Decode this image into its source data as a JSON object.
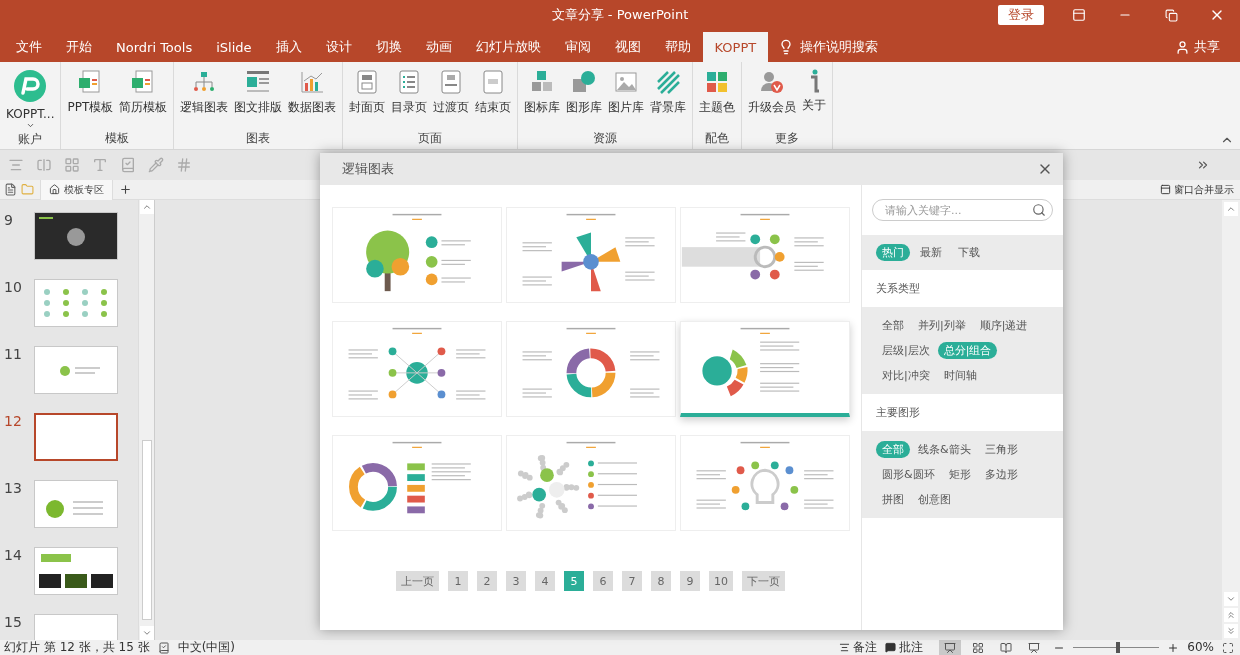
{
  "window": {
    "title": "文章分享 - PowerPoint",
    "login": "登录"
  },
  "menu_tabs": [
    {
      "label": "文件",
      "selected": false
    },
    {
      "label": "开始",
      "selected": false
    },
    {
      "label": "Nordri Tools",
      "selected": false
    },
    {
      "label": "iSlide",
      "selected": false
    },
    {
      "label": "插入",
      "selected": false
    },
    {
      "label": "设计",
      "selected": false
    },
    {
      "label": "切换",
      "selected": false
    },
    {
      "label": "动画",
      "selected": false
    },
    {
      "label": "幻灯片放映",
      "selected": false
    },
    {
      "label": "审阅",
      "selected": false
    },
    {
      "label": "视图",
      "selected": false
    },
    {
      "label": "帮助",
      "selected": false
    },
    {
      "label": "KOPPT",
      "selected": true
    }
  ],
  "tell_me": "操作说明搜索",
  "share": "共享",
  "ribbon_groups": [
    {
      "label": "账户",
      "buttons": [
        {
          "label": "KOPPT...",
          "kind": "logo"
        }
      ]
    },
    {
      "label": "模板",
      "buttons": [
        {
          "label": "PPT模板",
          "kind": "ppt"
        },
        {
          "label": "简历模板",
          "kind": "cv"
        }
      ]
    },
    {
      "label": "图表",
      "buttons": [
        {
          "label": "逻辑图表",
          "kind": "org"
        },
        {
          "label": "图文排版",
          "kind": "layout"
        },
        {
          "label": "数据图表",
          "kind": "chart"
        }
      ]
    },
    {
      "label": "页面",
      "buttons": [
        {
          "label": "封面页",
          "kind": "cover"
        },
        {
          "label": "目录页",
          "kind": "list"
        },
        {
          "label": "过渡页",
          "kind": "transition"
        },
        {
          "label": "结束页",
          "kind": "end"
        }
      ]
    },
    {
      "label": "资源",
      "buttons": [
        {
          "label": "图标库",
          "kind": "cubes"
        },
        {
          "label": "图形库",
          "kind": "shapes"
        },
        {
          "label": "图片库",
          "kind": "image"
        },
        {
          "label": "背景库",
          "kind": "stripes"
        }
      ]
    },
    {
      "label": "配色",
      "buttons": [
        {
          "label": "主题色",
          "kind": "palette"
        }
      ]
    },
    {
      "label": "更多",
      "buttons": [
        {
          "label": "升级会员",
          "kind": "vip"
        },
        {
          "label": "关于",
          "kind": "info"
        }
      ]
    }
  ],
  "doc_tab": "模板专区",
  "merge_window": "窗口合并显示",
  "slides": [
    {
      "number": "9",
      "selected": false,
      "kind": "dark"
    },
    {
      "number": "10",
      "selected": false,
      "kind": "grid"
    },
    {
      "number": "11",
      "selected": false,
      "kind": "light"
    },
    {
      "number": "12",
      "selected": true,
      "kind": "blank"
    },
    {
      "number": "13",
      "selected": false,
      "kind": "green"
    },
    {
      "number": "14",
      "selected": false,
      "kind": "photos"
    },
    {
      "number": "15",
      "selected": false,
      "kind": "blank"
    }
  ],
  "dialog": {
    "title": "逻辑图表",
    "templates": [
      {
        "kind": "tree",
        "selected": false
      },
      {
        "kind": "pinwheel",
        "selected": false
      },
      {
        "kind": "flow",
        "selected": false
      },
      {
        "kind": "radial",
        "selected": false
      },
      {
        "kind": "circle",
        "selected": false
      },
      {
        "kind": "fan",
        "selected": true
      },
      {
        "kind": "ring",
        "selected": false
      },
      {
        "kind": "bubbles",
        "selected": false
      },
      {
        "kind": "bulb",
        "selected": false
      }
    ],
    "pagination": {
      "prev": "上一页",
      "next": "下一页",
      "pages": [
        {
          "label": "1",
          "selected": false
        },
        {
          "label": "2",
          "selected": false
        },
        {
          "label": "3",
          "selected": false
        },
        {
          "label": "4",
          "selected": false
        },
        {
          "label": "5",
          "selected": true
        },
        {
          "label": "6",
          "selected": false
        },
        {
          "label": "7",
          "selected": false
        },
        {
          "label": "8",
          "selected": false
        },
        {
          "label": "9",
          "selected": false
        },
        {
          "label": "10",
          "selected": false
        }
      ]
    },
    "search": {
      "placeholder": "请输入关键字..."
    },
    "sort_tabs": [
      {
        "label": "热门",
        "selected": true
      },
      {
        "label": "最新",
        "selected": false
      },
      {
        "label": "下载",
        "selected": false
      }
    ],
    "sections": [
      {
        "title": "关系类型",
        "options": [
          {
            "label": "全部",
            "selected": false
          },
          {
            "label": "并列|列举",
            "selected": false
          },
          {
            "label": "顺序|递进",
            "selected": false
          },
          {
            "label": "层级|层次",
            "selected": false
          },
          {
            "label": "总分|组合",
            "selected": true
          },
          {
            "label": "对比|冲突",
            "selected": false
          },
          {
            "label": "时间轴",
            "selected": false
          }
        ]
      },
      {
        "title": "主要图形",
        "options": [
          {
            "label": "全部",
            "selected": true
          },
          {
            "label": "线条&箭头",
            "selected": false
          },
          {
            "label": "三角形",
            "selected": false
          },
          {
            "label": "圆形&圆环",
            "selected": false
          },
          {
            "label": "矩形",
            "selected": false
          },
          {
            "label": "多边形",
            "selected": false
          },
          {
            "label": "拼图",
            "selected": false
          },
          {
            "label": "创意图",
            "selected": false
          }
        ]
      }
    ]
  },
  "status_bar": {
    "slide_info": "幻灯片 第 12 张，共 15 张",
    "language": "中文(中国)",
    "notes": "备注",
    "comments": "批注",
    "zoom": "60%",
    "zoom_slider": {
      "level": 0.5
    },
    "views": [
      {
        "kind": "normal",
        "selected": true
      },
      {
        "kind": "sorter",
        "selected": false
      },
      {
        "kind": "reading",
        "selected": false
      },
      {
        "kind": "show",
        "selected": false
      }
    ]
  }
}
